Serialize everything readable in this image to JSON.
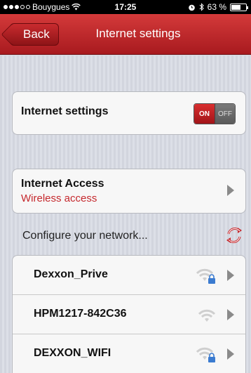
{
  "status_bar": {
    "carrier": "Bouygues",
    "time": "17:25",
    "battery": "63 %",
    "battery_level": 0.63,
    "icons": [
      "signal-dots",
      "wifi-icon",
      "alarm-icon",
      "bluetooth-icon",
      "battery-icon"
    ]
  },
  "nav": {
    "back_label": "Back",
    "title": "Internet settings"
  },
  "settings_card": {
    "label": "Internet settings",
    "toggle_on": "ON",
    "toggle_off": "OFF",
    "toggle_state": "on"
  },
  "access_card": {
    "label": "Internet Access",
    "sublabel": "Wireless access"
  },
  "networks": {
    "header": "Configure your network...",
    "items": [
      {
        "name": "Dexxon_Prive",
        "secured": true
      },
      {
        "name": "HPM1217-842C36",
        "secured": false
      },
      {
        "name": "DEXXON_WIFI",
        "secured": true
      }
    ]
  },
  "colors": {
    "accent": "#b51f24",
    "sublabel": "#c5282d"
  }
}
